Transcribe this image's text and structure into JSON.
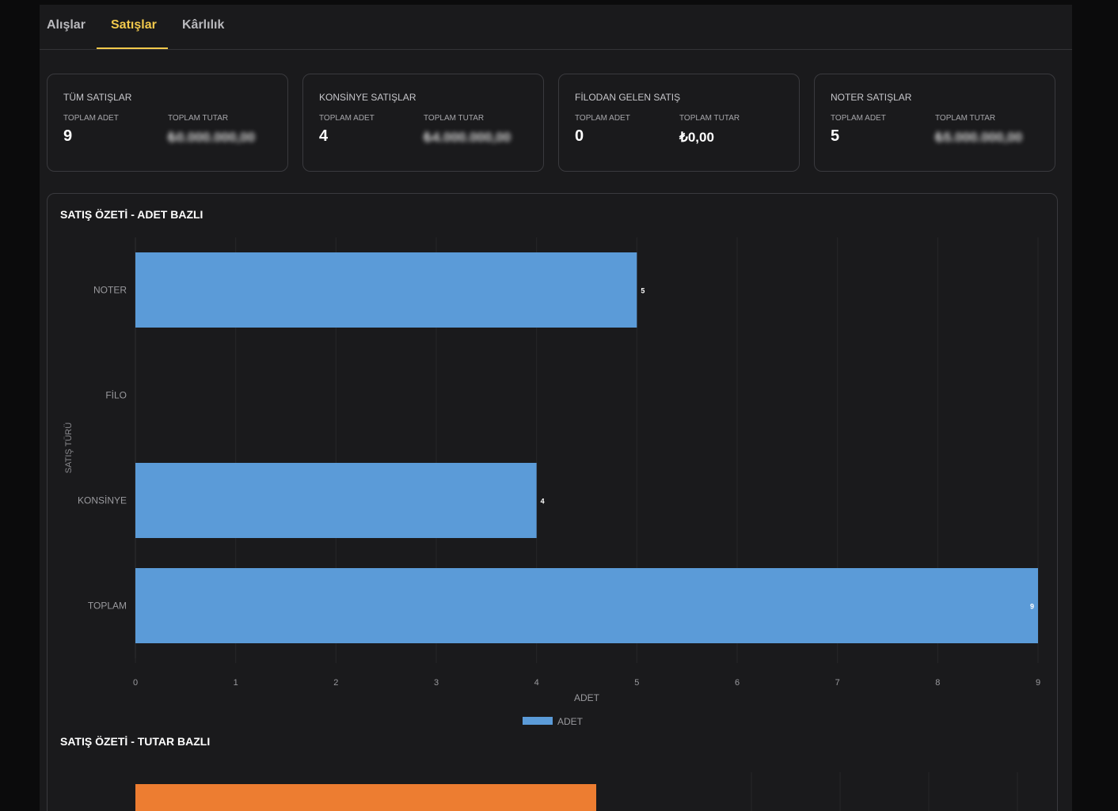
{
  "tabs": [
    {
      "label": "Alışlar"
    },
    {
      "label": "Satışlar"
    },
    {
      "label": "Kârlılık"
    }
  ],
  "active_tab": "Satışlar",
  "cards": [
    {
      "title": "TÜM SATIŞLAR",
      "adet_label": "TOPLAM ADET",
      "tutar_label": "TOPLAM TUTAR",
      "adet": "9",
      "tutar": "₺0.000.000,00"
    },
    {
      "title": "KONSİNYE SATIŞLAR",
      "adet_label": "TOPLAM ADET",
      "tutar_label": "TOPLAM TUTAR",
      "adet": "4",
      "tutar": "₺4.000.000,00"
    },
    {
      "title": "FİLODAN GELEN SATIŞ",
      "adet_label": "TOPLAM ADET",
      "tutar_label": "TOPLAM TUTAR",
      "adet": "0",
      "tutar": "₺0,00"
    },
    {
      "title": "NOTER SATIŞLAR",
      "adet_label": "TOPLAM ADET",
      "tutar_label": "TOPLAM TUTAR",
      "adet": "5",
      "tutar": "₺5.000.000,00"
    }
  ],
  "sections": {
    "adet_title": "SATIŞ ÖZETİ - ADET BAZLI",
    "tutar_title": "SATIŞ ÖZETİ - TUTAR BAZLI"
  },
  "colors": {
    "accent": "#f2c94c",
    "bar_adet": "#5b9bd8",
    "bar_tutar": "#ed7d31"
  },
  "chart_data": {
    "type": "bar",
    "orientation": "horizontal",
    "categories": [
      "NOTER",
      "FİLO",
      "KONSİNYE",
      "TOPLAM"
    ],
    "series": [
      {
        "name": "ADET",
        "values": [
          5,
          0,
          4,
          9
        ]
      }
    ],
    "xlabel": "ADET",
    "ylabel": "SATIŞ TÜRÜ",
    "xlim": [
      0,
      9
    ],
    "xticks": [
      0,
      1,
      2,
      3,
      4,
      5,
      6,
      7,
      8,
      9
    ],
    "data_labels": true,
    "legend": "bottom",
    "grid": true
  }
}
